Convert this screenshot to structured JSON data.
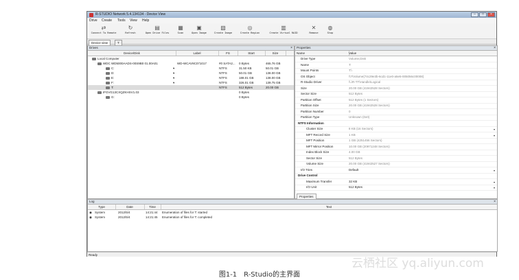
{
  "window": {
    "title": "R-STUDIO Network 5.4.134134 - Device View"
  },
  "menu": [
    "Drive",
    "Create",
    "Tools",
    "View",
    "Help"
  ],
  "toolbar": [
    {
      "label": "Connect To Remote",
      "icon": "connect-icon"
    },
    {
      "label": "Refresh",
      "icon": "refresh-icon"
    },
    {
      "label": "Open Drive Files",
      "icon": "open-files-icon"
    },
    {
      "label": "Scan",
      "icon": "scan-icon"
    },
    {
      "label": "Open Image",
      "icon": "open-image-icon"
    },
    {
      "label": "Create Image",
      "icon": "create-image-icon"
    },
    {
      "label": "Create Region",
      "icon": "create-region-icon"
    },
    {
      "label": "Create Virtual RAID",
      "icon": "raid-icon"
    },
    {
      "label": "Remove",
      "icon": "remove-icon"
    },
    {
      "label": "Stop",
      "icon": "stop-icon"
    }
  ],
  "tabs": [
    {
      "label": "Device view"
    },
    {
      "label": "T"
    }
  ],
  "drives": {
    "title": "Drives",
    "columns": [
      "Device/Disk",
      "Label",
      "FS",
      "Start",
      "Size"
    ],
    "rows": [
      {
        "name": "Local Computer",
        "label": "",
        "fs": "",
        "start": "",
        "size": ""
      },
      {
        "name": "WDC WD5000AADS-00S9B0 01.00A01",
        "label": "WD-WCAV9C071017",
        "fs": "#0 SATA2...",
        "start": "0 Bytes",
        "size": "465.76 GB"
      },
      {
        "name": "C:",
        "label": "",
        "fs": "NTFS",
        "start": "31.50 KB",
        "size": "50.01 GB"
      },
      {
        "name": "D:",
        "label": "",
        "fs": "NTFS",
        "start": "50.01 GB",
        "size": "138.00 GB"
      },
      {
        "name": "E:",
        "label": "",
        "fs": "NTFS",
        "start": "188.01 GB",
        "size": "138.00 GB"
      },
      {
        "name": "F:",
        "label": "",
        "fs": "NTFS",
        "start": "326.01 GB",
        "size": "139.75 GB"
      },
      {
        "name": "T:",
        "label": "",
        "fs": "NTFS",
        "start": "512 Bytes",
        "size": "20.00 GB"
      },
      {
        "name": "IFGVG13CXQZKHSV1.03",
        "label": "",
        "fs": "",
        "start": "0 Bytes",
        "size": ""
      },
      {
        "name": "G:",
        "label": "",
        "fs": "",
        "start": "0 Bytes",
        "size": ""
      }
    ]
  },
  "properties": {
    "title": "Properties",
    "columns": [
      "Name",
      "Value"
    ],
    "rows": [
      {
        "name": "Drive Type",
        "value": "Volume,Disk"
      },
      {
        "name": "Name",
        "value": "T:"
      },
      {
        "name": "Mount Points",
        "value": "T:\\"
      },
      {
        "name": "OS Object",
        "value": "\\\\?\\Volume{74c29e3b-6cd1-11e0-a5e5-005056c00008}"
      },
      {
        "name": "R-Studio Driver",
        "value": "\\\\.\\R-TT\\Handle\\Logical"
      },
      {
        "name": "Size",
        "value": "20.00 GB (41942528 Sectors)"
      },
      {
        "name": "Sector Size",
        "value": "512 Bytes"
      },
      {
        "name": "Partition Offset",
        "value": "512 Bytes (1 Sectors)"
      },
      {
        "name": "Partition Size",
        "value": "20.00 GB (41942528 Sectors)"
      },
      {
        "name": "Partition Number",
        "value": "0"
      },
      {
        "name": "Partition Type",
        "value": "Unknown (0x0)"
      },
      {
        "name": "NTFS Information",
        "value": "",
        "section": true
      },
      {
        "name": "Cluster Size",
        "value": "8 KB (16 Sectors)",
        "dropdown": true
      },
      {
        "name": "MFT Record Size",
        "value": "1 KB",
        "dropdown": true
      },
      {
        "name": "MFT Position",
        "value": "1 GB (4251456 Sectors)"
      },
      {
        "name": "MFT Mirror Position",
        "value": "10.00 GB (20971248 Sectors)"
      },
      {
        "name": "Index Block Size",
        "value": "4.00 GB"
      },
      {
        "name": "Sector Size",
        "value": "512 Bytes"
      },
      {
        "name": "Volume Size",
        "value": "20.00 GB (41942527 Sectors)"
      },
      {
        "name": "I/O Tries",
        "value": "Default",
        "dropdown": true,
        "dark": true
      },
      {
        "name": "Drive Control",
        "value": "",
        "section": true
      },
      {
        "name": "Maximum Transfer",
        "value": "32 KB",
        "dropdown": true,
        "dark": true
      },
      {
        "name": "I/O Unit",
        "value": "512 Bytes",
        "dropdown": true,
        "dark": true
      }
    ],
    "tab_label": "Properties"
  },
  "log": {
    "title": "Log",
    "columns": [
      "Type",
      "Date",
      "Time",
      "Text"
    ],
    "rows": [
      {
        "type": "System",
        "date": "2012/5/4",
        "time": "14:21:44",
        "text": "Enumeration of files for T: started"
      },
      {
        "type": "System",
        "date": "2012/5/4",
        "time": "14:21:45",
        "text": "Enumeration of files for T: completed"
      }
    ]
  },
  "status": "Ready",
  "caption": "图1-1　R-Studio的主界面",
  "watermark": "云栖社区 yq.aliyun.com"
}
